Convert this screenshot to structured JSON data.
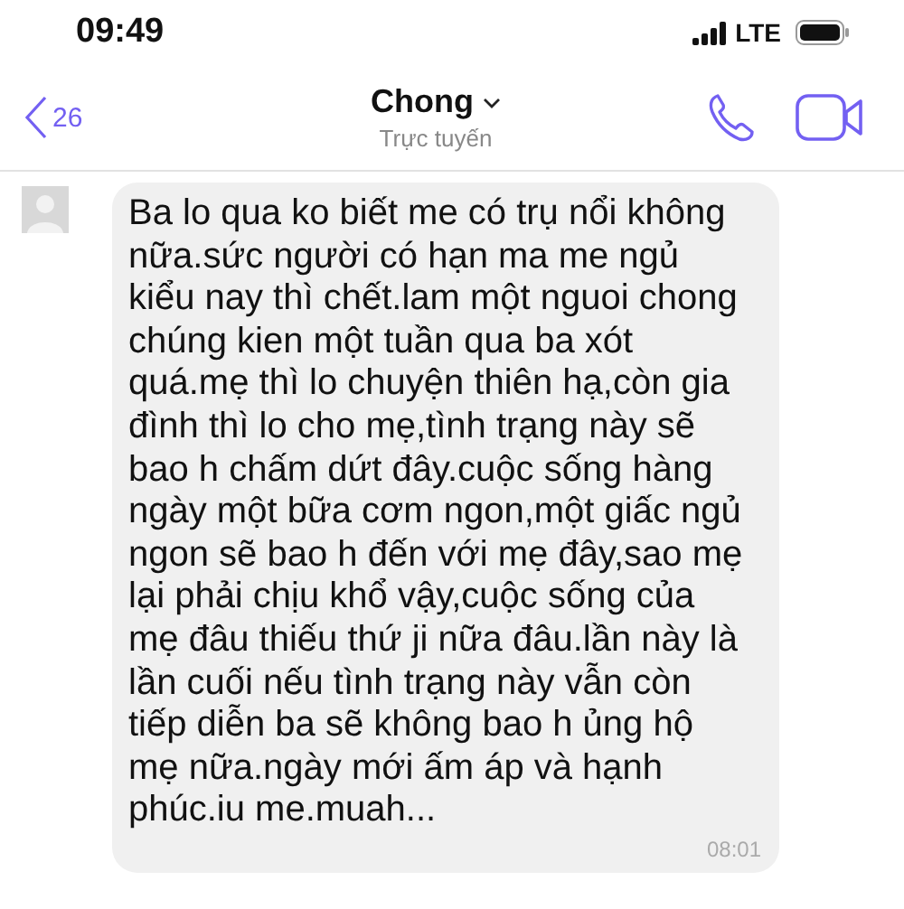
{
  "status_bar": {
    "time": "09:49",
    "network": "LTE"
  },
  "header": {
    "back_count": "26",
    "contact_name": "Chong",
    "contact_status": "Trực tuyến"
  },
  "messages": [
    {
      "text": "Ba lo qua ko biết me có trụ nổi không nữa.sức người có hạn ma me ngủ kiểu nay thì chết.lam một nguoi chong chúng kien một tuần qua ba xót quá.mẹ thì lo chuyện thiên hạ,còn gia đình thì lo cho mẹ,tình trạng này sẽ bao h chấm dứt đây.cuộc sống hàng ngày một bữa cơm ngon,một giấc ngủ ngon sẽ bao h đến với mẹ đây,sao mẹ lại phải chịu khổ vậy,cuộc sống của mẹ đâu thiếu thứ ji nữa đâu.lần này là lần cuối nếu tình trạng này vẫn còn tiếp diễn ba sẽ không bao h ủng hộ mẹ nữa.ngày mới ấm áp và hạnh phúc.iu me.muah...",
      "time": "08:01"
    }
  ]
}
